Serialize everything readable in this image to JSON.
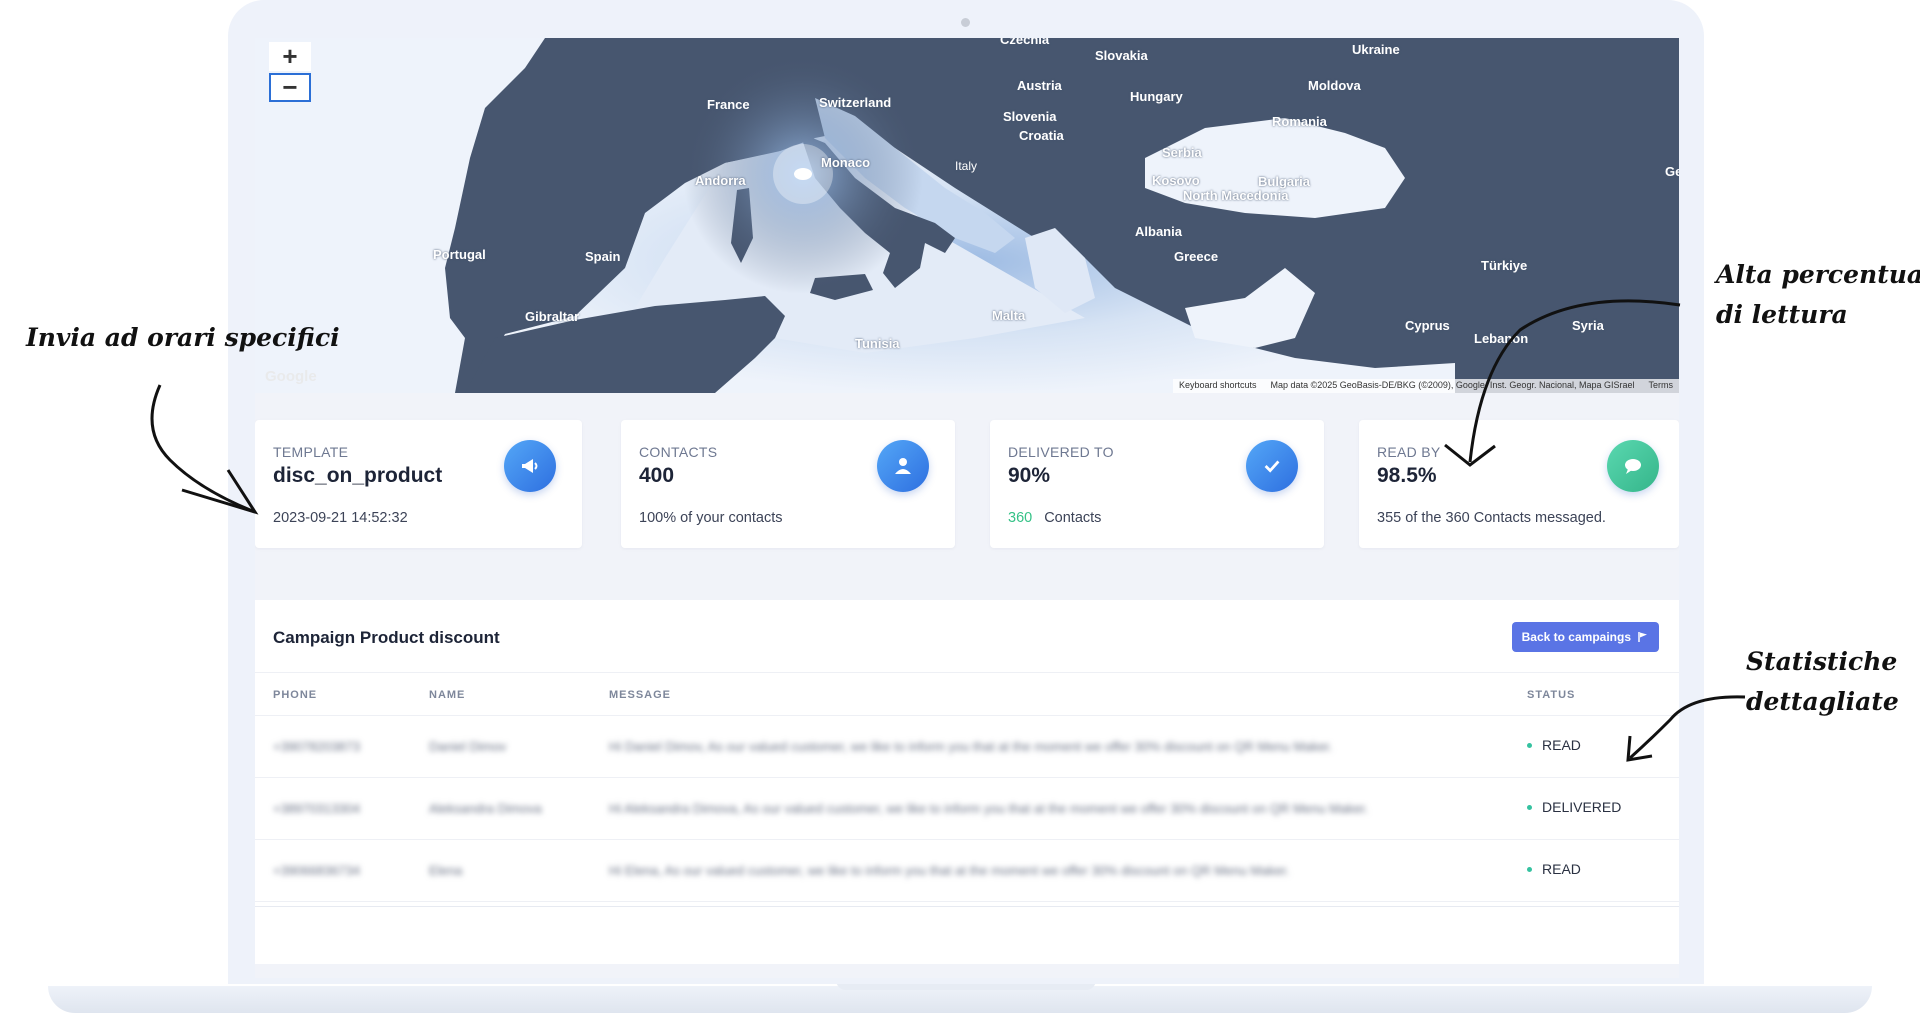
{
  "map": {
    "zoom_in": "+",
    "zoom_out": "−",
    "google": "Google",
    "attribution": [
      "Keyboard shortcuts",
      "Map data ©2025 GeoBasis-DE/BKG (©2009), Google, Inst. Geogr. Nacional, Mapa GISrael",
      "Terms"
    ],
    "labels": [
      "Czechia",
      "Slovakia",
      "Ukraine",
      "Austria",
      "Moldova",
      "France",
      "Switzerland",
      "Hungary",
      "Slovenia",
      "Romania",
      "Croatia",
      "Monaco",
      "Serbia",
      "Italy",
      "Andorra",
      "Kosovo",
      "Bulgaria",
      "North Macedonia",
      "Albania",
      "Portugal",
      "Spain",
      "Greece",
      "Türkiye",
      "Gibraltar",
      "Malta",
      "Tunisia",
      "Cyprus",
      "Syria",
      "Lebanon",
      "Geo"
    ]
  },
  "cards": [
    {
      "label": "TEMPLATE",
      "value": "disc_on_product",
      "sub": "2023-09-21 14:52:32",
      "icon": "megaphone-icon",
      "color": "#3a8be8"
    },
    {
      "label": "CONTACTS",
      "value": "400",
      "sub": "100% of your contacts",
      "icon": "user-icon",
      "color": "#3a8be8"
    },
    {
      "label": "DELIVERED TO",
      "value": "90%",
      "sub_count": "360",
      "sub": "Contacts",
      "icon": "check-icon",
      "color": "#3a8be8"
    },
    {
      "label": "READ BY",
      "value": "98.5%",
      "sub": "355 of the 360 Contacts messaged.",
      "icon": "chat-icon",
      "color": "#45c9a0"
    }
  ],
  "campaign": {
    "title": "Campaign Product discount",
    "back_button": "Back to campaings",
    "columns": [
      "PHONE",
      "NAME",
      "MESSAGE",
      "STATUS"
    ],
    "rows": [
      {
        "phone": "+39078203873",
        "name": "Daniel Dimov",
        "message": "Hi Daniel Dimov, As our valued customer, we like to inform you that at the moment we offer 30% discount on QR Menu Maker.",
        "status": "READ"
      },
      {
        "phone": "+38970313304",
        "name": "Aleksandra Dimova",
        "message": "Hi Aleksandra Dimova, As our valued customer, we like to inform you that at the moment we offer 30% discount on QR Menu Maker.",
        "status": "DELIVERED"
      },
      {
        "phone": "+39066836734",
        "name": "Elena",
        "message": "Hi Elena, As our valued customer, we like to inform you that at the moment we offer 30% discount on QR Menu Maker.",
        "status": "READ"
      }
    ]
  },
  "annotations": {
    "left": "Invia ad orari specifici",
    "right_top_1": "Alta percentuale",
    "right_top_2": "di lettura",
    "right_bottom_1": "Statistiche",
    "right_bottom_2": "dettagliate"
  }
}
